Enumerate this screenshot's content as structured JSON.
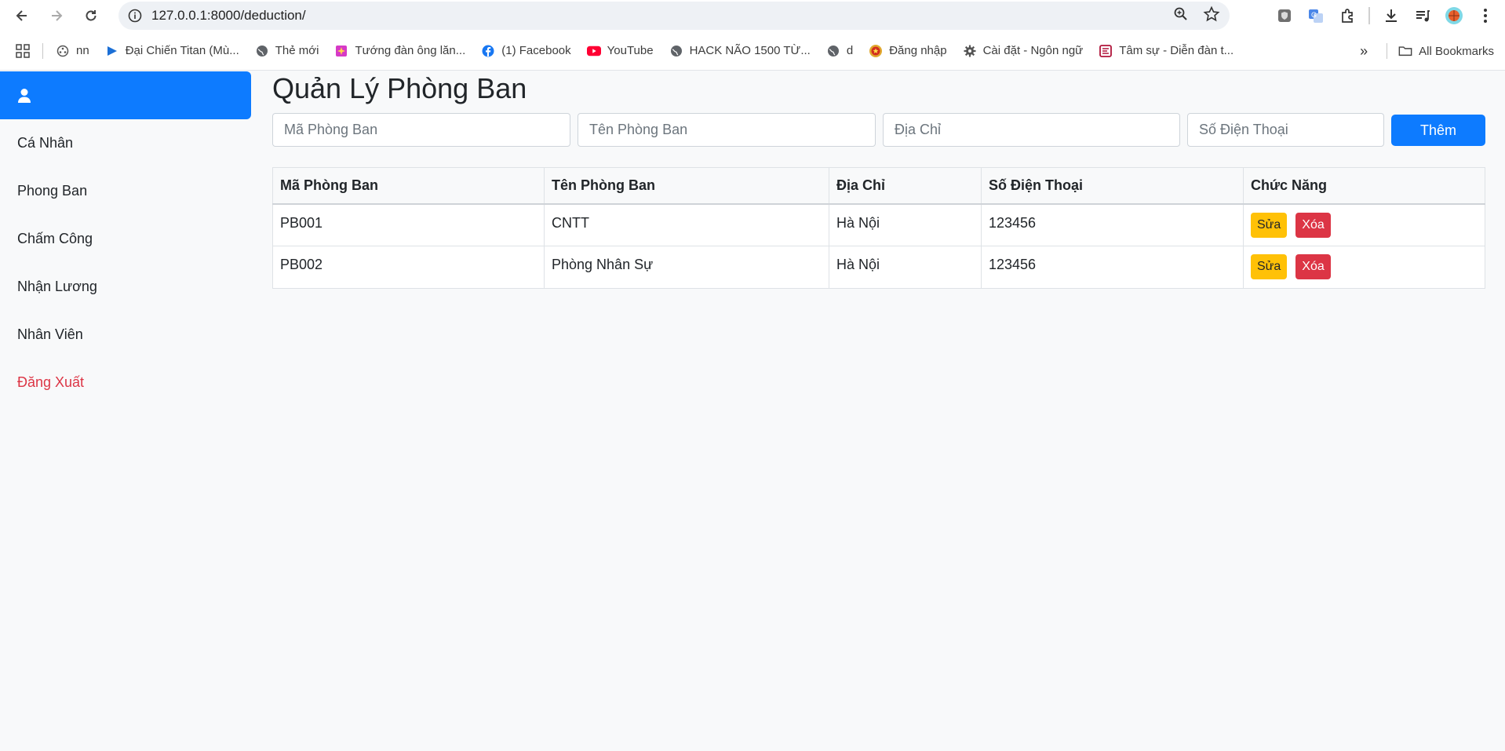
{
  "browser": {
    "url": "127.0.0.1:8000/deduction/",
    "bookmarks": [
      {
        "label": "nn",
        "icon": "film-reel-icon"
      },
      {
        "label": "Đại Chiến Titan (Mù...",
        "icon": "play-triangle-icon"
      },
      {
        "label": "Thẻ mới",
        "icon": "globe-icon"
      },
      {
        "label": "Tướng đàn ông lăn...",
        "icon": "sparkle-image-icon"
      },
      {
        "label": "(1) Facebook",
        "icon": "facebook-icon"
      },
      {
        "label": "YouTube",
        "icon": "youtube-icon"
      },
      {
        "label": "HACK NÃO 1500 TỪ...",
        "icon": "globe-icon"
      },
      {
        "label": "d",
        "icon": "globe-icon"
      },
      {
        "label": "Đăng nhập",
        "icon": "emblem-icon"
      },
      {
        "label": "Cài đặt - Ngôn ngữ",
        "icon": "gear-icon"
      },
      {
        "label": "Tâm sự - Diễn đàn t...",
        "icon": "forum-icon"
      }
    ],
    "all_bookmarks": "All Bookmarks"
  },
  "sidebar": {
    "items": [
      {
        "label": "Cá Nhân"
      },
      {
        "label": "Phong Ban"
      },
      {
        "label": "Chấm Công"
      },
      {
        "label": "Nhận Lương"
      },
      {
        "label": "Nhân Viên"
      },
      {
        "label": "Đăng Xuất"
      }
    ]
  },
  "main": {
    "title": "Quản Lý Phòng Ban",
    "form": {
      "code_placeholder": "Mã Phòng Ban",
      "name_placeholder": "Tên Phòng Ban",
      "address_placeholder": "Địa Chỉ",
      "phone_placeholder": "Số Điện Thoại",
      "add_label": "Thêm"
    },
    "table": {
      "headers": [
        "Mã Phòng Ban",
        "Tên Phòng Ban",
        "Địa Chỉ",
        "Số Điện Thoại",
        "Chức Năng"
      ],
      "rows": [
        {
          "code": "PB001",
          "name": "CNTT",
          "address": "Hà Nội",
          "phone": "123456"
        },
        {
          "code": "PB002",
          "name": "Phòng Nhân Sự",
          "address": "Hà Nội",
          "phone": "123456"
        }
      ],
      "edit_label": "Sửa",
      "delete_label": "Xóa"
    }
  },
  "colors": {
    "primary": "#0d7bff",
    "warning": "#ffc107",
    "danger": "#dc3545"
  }
}
